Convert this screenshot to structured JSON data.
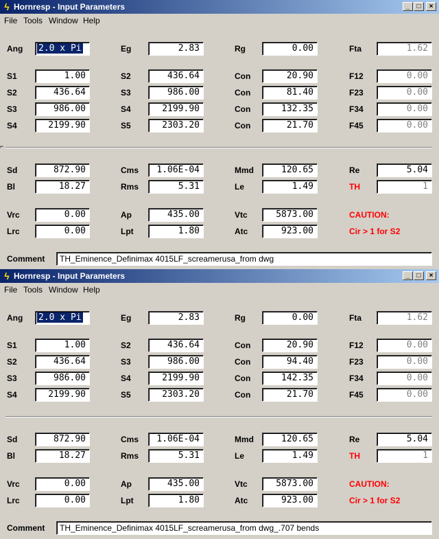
{
  "windows": [
    {
      "title": "Hornresp - Input Parameters",
      "menu": [
        "File",
        "Tools",
        "Window",
        "Help"
      ],
      "controls": [
        "_",
        "□",
        "×"
      ],
      "ang": {
        "label": "Ang",
        "value": "2.0 x Pi"
      },
      "eg": {
        "label": "Eg",
        "value": "2.83"
      },
      "rg": {
        "label": "Rg",
        "value": "0.00"
      },
      "fta": {
        "label": "Fta",
        "value": "1.62"
      },
      "rows": [
        {
          "s_label": "S1",
          "s_value": "1.00",
          "s2_label": "S2",
          "s2_value": "436.64",
          "con_label": "Con",
          "con_value": "20.90",
          "f_label": "F12",
          "f_value": "0.00"
        },
        {
          "s_label": "S2",
          "s_value": "436.64",
          "s2_label": "S3",
          "s2_value": "986.00",
          "con_label": "Con",
          "con_value": "81.40",
          "f_label": "F23",
          "f_value": "0.00"
        },
        {
          "s_label": "S3",
          "s_value": "986.00",
          "s2_label": "S4",
          "s2_value": "2199.90",
          "con_label": "Con",
          "con_value": "132.35",
          "f_label": "F34",
          "f_value": "0.00"
        },
        {
          "s_label": "S4",
          "s_value": "2199.90",
          "s2_label": "S5",
          "s2_value": "2303.20",
          "con_label": "Con",
          "con_value": "21.70",
          "f_label": "F45",
          "f_value": "0.00"
        }
      ],
      "sd": {
        "label": "Sd",
        "value": "872.90"
      },
      "cms": {
        "label": "Cms",
        "value": "1.06E-04"
      },
      "mmd": {
        "label": "Mmd",
        "value": "120.65"
      },
      "re": {
        "label": "Re",
        "value": "5.04"
      },
      "bl": {
        "label": "Bl",
        "value": "18.27"
      },
      "rms": {
        "label": "Rms",
        "value": "5.31"
      },
      "le": {
        "label": "Le",
        "value": "1.49"
      },
      "th": {
        "label": "TH",
        "value": "1"
      },
      "vrc": {
        "label": "Vrc",
        "value": "0.00"
      },
      "ap": {
        "label": "Ap",
        "value": "435.00"
      },
      "vtc": {
        "label": "Vtc",
        "value": "5873.00"
      },
      "lrc": {
        "label": "Lrc",
        "value": "0.00"
      },
      "lpt": {
        "label": "Lpt",
        "value": "1.80"
      },
      "atc": {
        "label": "Atc",
        "value": "923.00"
      },
      "caution": "CAUTION:",
      "caution_detail": "Cir > 1 for S2",
      "comment_label": "Comment",
      "comment": "TH_Eminence_Definimax 4015LF_screamerusa_from dwg"
    },
    {
      "title": "Hornresp - Input Parameters",
      "menu": [
        "File",
        "Tools",
        "Window",
        "Help"
      ],
      "controls": [
        "_",
        "□",
        "×"
      ],
      "ang": {
        "label": "Ang",
        "value": "2.0 x Pi"
      },
      "eg": {
        "label": "Eg",
        "value": "2.83"
      },
      "rg": {
        "label": "Rg",
        "value": "0.00"
      },
      "fta": {
        "label": "Fta",
        "value": "1.62"
      },
      "rows": [
        {
          "s_label": "S1",
          "s_value": "1.00",
          "s2_label": "S2",
          "s2_value": "436.64",
          "con_label": "Con",
          "con_value": "20.90",
          "f_label": "F12",
          "f_value": "0.00"
        },
        {
          "s_label": "S2",
          "s_value": "436.64",
          "s2_label": "S3",
          "s2_value": "986.00",
          "con_label": "Con",
          "con_value": "94.40",
          "f_label": "F23",
          "f_value": "0.00"
        },
        {
          "s_label": "S3",
          "s_value": "986.00",
          "s2_label": "S4",
          "s2_value": "2199.90",
          "con_label": "Con",
          "con_value": "142.35",
          "f_label": "F34",
          "f_value": "0.00"
        },
        {
          "s_label": "S4",
          "s_value": "2199.90",
          "s2_label": "S5",
          "s2_value": "2303.20",
          "con_label": "Con",
          "con_value": "21.70",
          "f_label": "F45",
          "f_value": "0.00"
        }
      ],
      "sd": {
        "label": "Sd",
        "value": "872.90"
      },
      "cms": {
        "label": "Cms",
        "value": "1.06E-04"
      },
      "mmd": {
        "label": "Mmd",
        "value": "120.65"
      },
      "re": {
        "label": "Re",
        "value": "5.04"
      },
      "bl": {
        "label": "Bl",
        "value": "18.27"
      },
      "rms": {
        "label": "Rms",
        "value": "5.31"
      },
      "le": {
        "label": "Le",
        "value": "1.49"
      },
      "th": {
        "label": "TH",
        "value": "1"
      },
      "vrc": {
        "label": "Vrc",
        "value": "0.00"
      },
      "ap": {
        "label": "Ap",
        "value": "435.00"
      },
      "vtc": {
        "label": "Vtc",
        "value": "5873.00"
      },
      "lrc": {
        "label": "Lrc",
        "value": "0.00"
      },
      "lpt": {
        "label": "Lpt",
        "value": "1.80"
      },
      "atc": {
        "label": "Atc",
        "value": "923.00"
      },
      "caution": "CAUTION:",
      "caution_detail": "Cir > 1 for S2",
      "comment_label": "Comment",
      "comment": "TH_Eminence_Definimax 4015LF_screamerusa_from dwg_.707 bends"
    }
  ],
  "icons": {
    "app_icon": "lightning-icon",
    "grip": "resize-grip-icon"
  },
  "colors": {
    "title_start": "#0a246a",
    "title_end": "#a6caf0",
    "window_bg": "#d4d0c8",
    "warning_red": "#ff0000",
    "disabled_gray": "#808080"
  }
}
